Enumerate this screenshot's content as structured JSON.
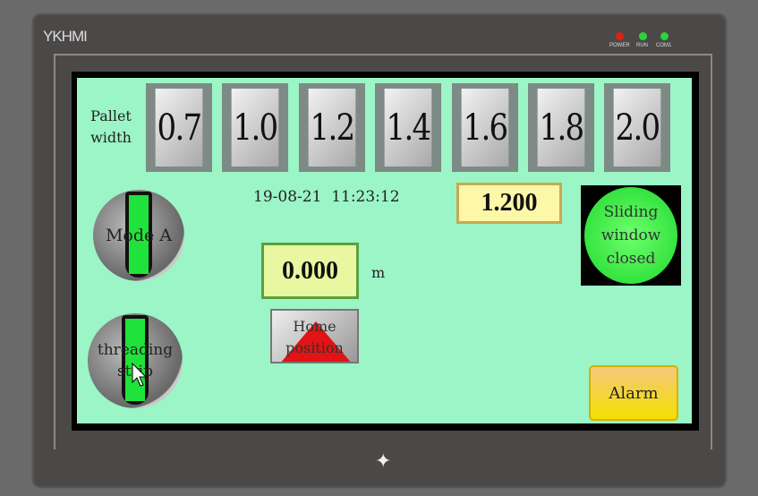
{
  "device": {
    "brand": "YKHMI",
    "leds": [
      {
        "label": "POWER",
        "color": "#e0201a"
      },
      {
        "label": "RUN",
        "color": "#2ad43a"
      },
      {
        "label": "COM1",
        "color": "#2ad43a"
      }
    ]
  },
  "pallet": {
    "label_line1": "Pallet",
    "label_line2": "width",
    "options": [
      "0.7",
      "1.0",
      "1.2",
      "1.4",
      "1.6",
      "1.8",
      "2.0"
    ]
  },
  "datetime": "19-08-21  11:23:12",
  "width_value": "1.200",
  "position": {
    "value": "0.000",
    "unit": "m"
  },
  "mode_switch": {
    "label": "Mode A"
  },
  "threading_switch": {
    "label_line1": "threading",
    "label_line2": "strip"
  },
  "home_button": {
    "line1": "Home",
    "line2": "position"
  },
  "window_status": {
    "line1": "Sliding",
    "line2": "window",
    "line3": "closed"
  },
  "alarm_button": "Alarm",
  "colors": {
    "panel": "#9bf5c6",
    "indicator_on": "#1fe33a"
  }
}
